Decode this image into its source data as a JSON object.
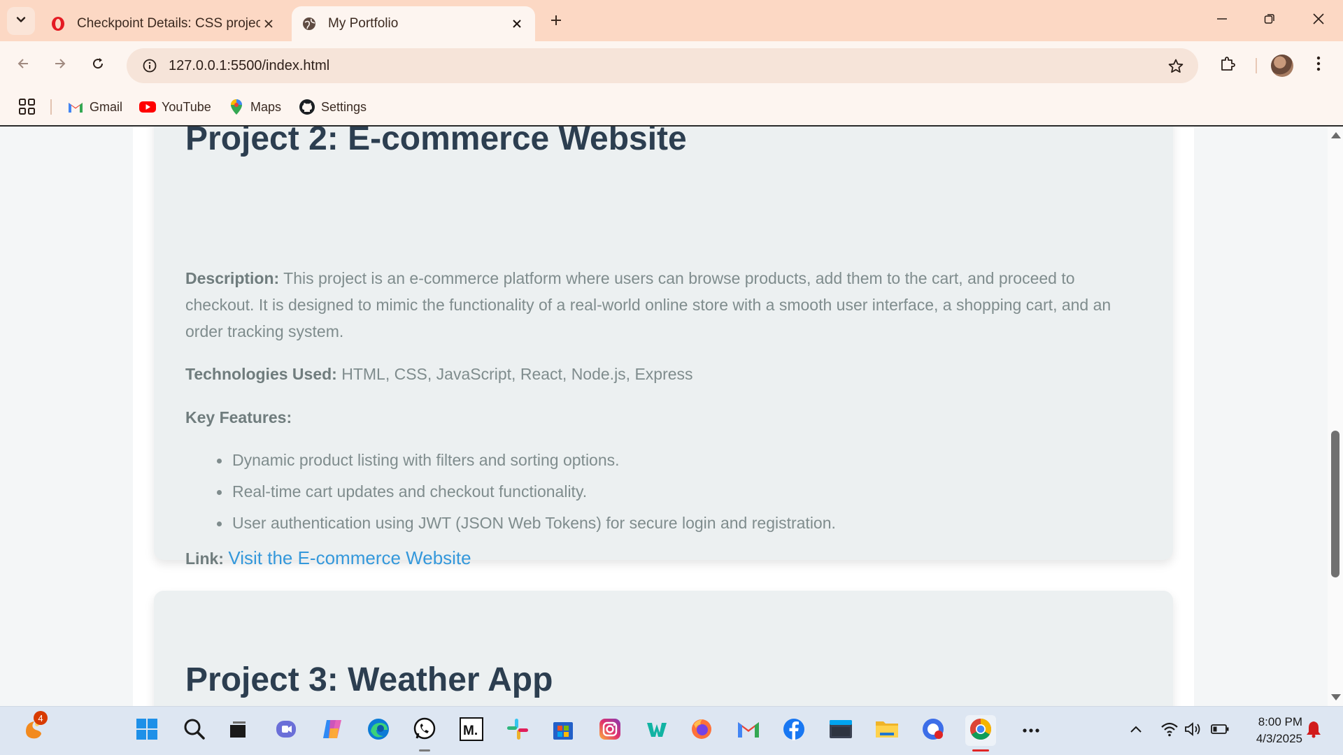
{
  "browser": {
    "tabs": [
      {
        "title": "Checkpoint Details: CSS project",
        "active": false
      },
      {
        "title": "My Portfolio",
        "active": true
      }
    ],
    "url": "127.0.0.1:5500/index.html",
    "bookmarks": [
      {
        "label": "Gmail",
        "icon": "gmail-icon"
      },
      {
        "label": "YouTube",
        "icon": "youtube-icon"
      },
      {
        "label": "Maps",
        "icon": "maps-icon"
      },
      {
        "label": "Settings",
        "icon": "github-icon"
      }
    ]
  },
  "page": {
    "project2": {
      "title": "Project 2: E-commerce Website",
      "description_label": "Description:",
      "description": "This project is an e-commerce platform where users can browse products, add them to the cart, and proceed to checkout. It is designed to mimic the functionality of a real-world online store with a smooth user interface, a shopping cart, and an order tracking system.",
      "tech_label": "Technologies Used:",
      "tech": "HTML, CSS, JavaScript, React, Node.js, Express",
      "features_label": "Key Features:",
      "features": [
        "Dynamic product listing with filters and sorting options.",
        "Real-time cart updates and checkout functionality.",
        "User authentication using JWT (JSON Web Tokens) for secure login and registration."
      ],
      "link_label": "Link:",
      "link_text": "Visit the E-commerce Website"
    },
    "project3": {
      "title": "Project 3: Weather App"
    }
  },
  "taskbar": {
    "notification_badge": "4",
    "time": "8:00 PM",
    "date": "4/3/2025"
  },
  "colors": {
    "tab_strip": "#fcd8c4",
    "heading": "#2c3e50",
    "body_text": "#7f8c8d",
    "link": "#3498db",
    "card": "#ecf0f1"
  }
}
